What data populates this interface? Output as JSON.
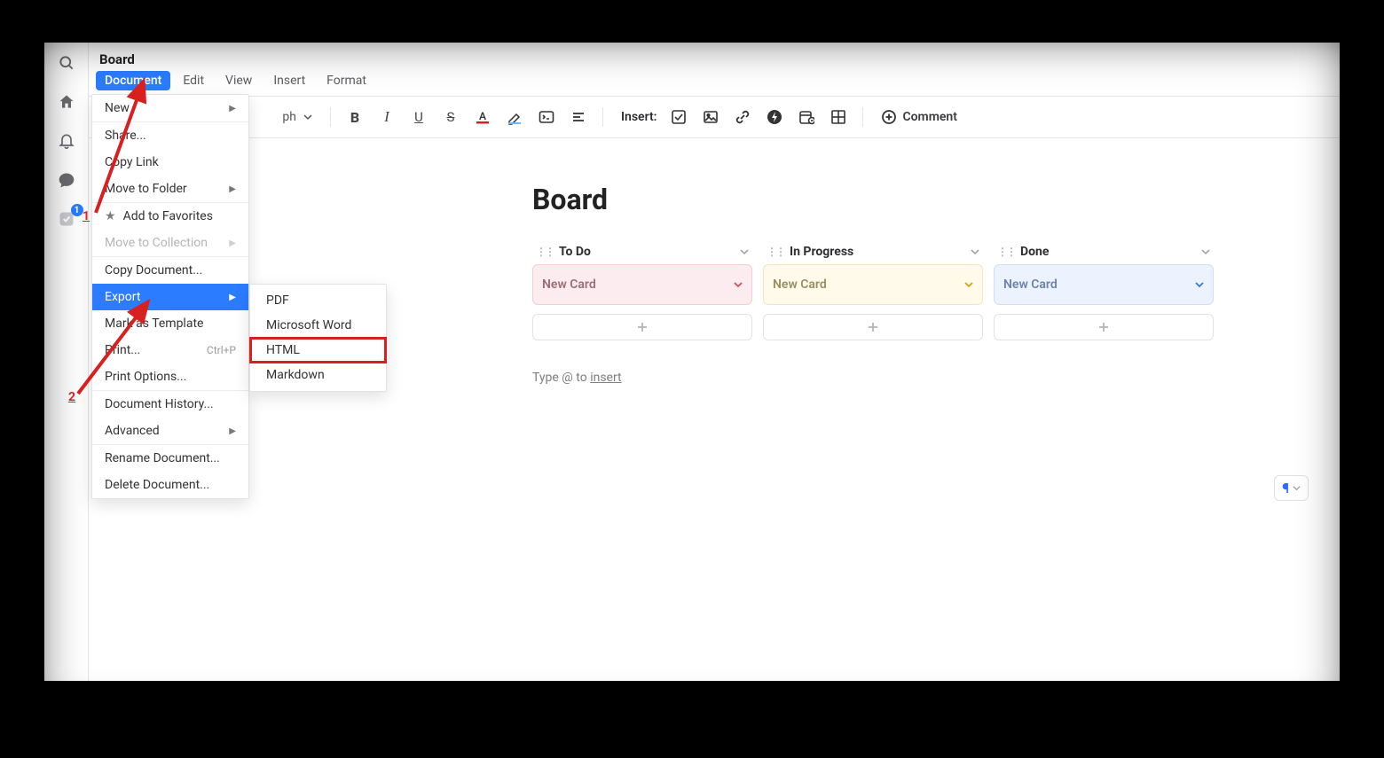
{
  "sidebar": {
    "badge": "1"
  },
  "doc_title_bar": "Board",
  "menubar": {
    "document": "Document",
    "edit": "Edit",
    "view": "View",
    "insert": "Insert",
    "format": "Format"
  },
  "toolbar": {
    "paragraph_partial": "ph",
    "insert_label": "Insert:",
    "comment_label": "Comment"
  },
  "document": {
    "title": "Board",
    "hint_prefix": "Type @ to ",
    "hint_link": "insert"
  },
  "board": {
    "columns": [
      {
        "title": "To Do",
        "card": "New Card",
        "variant": "todo"
      },
      {
        "title": "In Progress",
        "card": "New Card",
        "variant": "inprog"
      },
      {
        "title": "Done",
        "card": "New Card",
        "variant": "done"
      }
    ]
  },
  "dropdown": {
    "new": "New",
    "share": "Share...",
    "copy_link": "Copy Link",
    "move_to_folder": "Move to Folder",
    "add_to_favorites": "Add to Favorites",
    "move_to_collection": "Move to Collection",
    "copy_document": "Copy Document...",
    "export": "Export",
    "mark_as_template": "Mark as Template",
    "print": "Print...",
    "print_shortcut": "Ctrl+P",
    "print_options": "Print Options...",
    "document_history": "Document History...",
    "advanced": "Advanced",
    "rename_document": "Rename Document...",
    "delete_document": "Delete Document..."
  },
  "submenu": {
    "pdf": "PDF",
    "word": "Microsoft Word",
    "html": "HTML",
    "markdown": "Markdown"
  },
  "annotations": {
    "n1": "1",
    "n2": "2"
  }
}
